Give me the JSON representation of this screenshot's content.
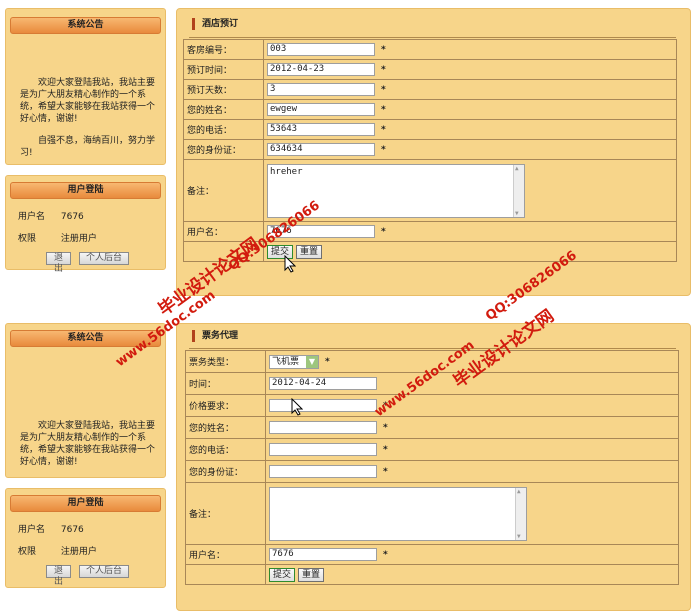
{
  "sidebar": {
    "notice_title": "系统公告",
    "notice_paragraphs": [
      "欢迎大家登陆我站，我站主要是为广大朋友精心制作的一个系统，希望大家能够在我站获得一个好心情，谢谢!",
      "自强不息，海纳百川，努力学习!"
    ],
    "login_title": "用户登陆",
    "username_label": "用户名",
    "username_value": "7676",
    "role_label": "权限",
    "role_value": "注册用户",
    "logout_button": "退出",
    "admin_button": "个人后台"
  },
  "hotel_form": {
    "title": "酒店预订",
    "fields": [
      {
        "label": "客房编号：",
        "value": "003"
      },
      {
        "label": "预订时间：",
        "value": "2012-04-23"
      },
      {
        "label": "预订天数：",
        "value": "3"
      },
      {
        "label": "您的姓名：",
        "value": "ewgew"
      },
      {
        "label": "您的电话：",
        "value": "53643"
      },
      {
        "label": "您的身份证：",
        "value": "634634"
      }
    ],
    "remark_label": "备注：",
    "remark_value": "hreher",
    "user_label": "用户名：",
    "user_value": "7676",
    "submit": "提交",
    "reset": "重置"
  },
  "ticket_form": {
    "title": "票务代理",
    "type_label": "票务类型：",
    "type_value": "飞机票",
    "fields": [
      {
        "label": "时间：",
        "value": "2012-04-24"
      },
      {
        "label": "价格要求：",
        "value": ""
      },
      {
        "label": "您的姓名：",
        "value": ""
      },
      {
        "label": "您的电话：",
        "value": ""
      },
      {
        "label": "您的身份证：",
        "value": ""
      }
    ],
    "remark_label": "备注：",
    "remark_value": "",
    "user_label": "用户名：",
    "user_value": "7676",
    "submit": "提交",
    "reset": "重置"
  },
  "required_mark": "*",
  "watermarks": {
    "site": "www.56doc.com",
    "qq": "QQ:306826066",
    "brand": "毕业设计论文网"
  },
  "colors": {
    "panel_bg": "#f7d58a",
    "title_bar": "#e88a3c",
    "watermark": "#d21b0e"
  }
}
